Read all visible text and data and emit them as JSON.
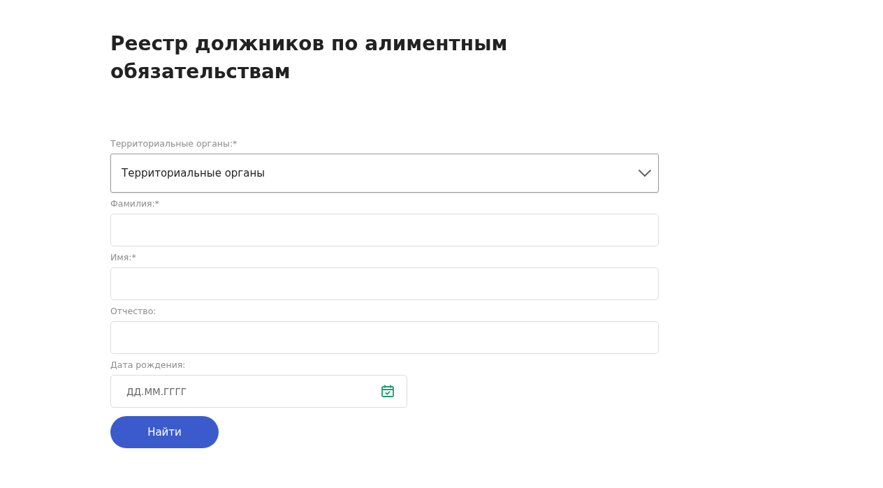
{
  "title": "Реестр должников по алиментным обязательствам",
  "fields": [
    {
      "kind": "select",
      "label": "Территориальные органы:*",
      "value": "Территориальные органы"
    },
    {
      "kind": "text",
      "label": "Фамилия:*"
    },
    {
      "kind": "text",
      "label": "Имя:*"
    },
    {
      "kind": "text",
      "label": "Отчество:"
    },
    {
      "kind": "date",
      "label": "Дата рождения:",
      "placeholder": "ДД.ММ.ГГГГ"
    }
  ],
  "button": "Найти"
}
